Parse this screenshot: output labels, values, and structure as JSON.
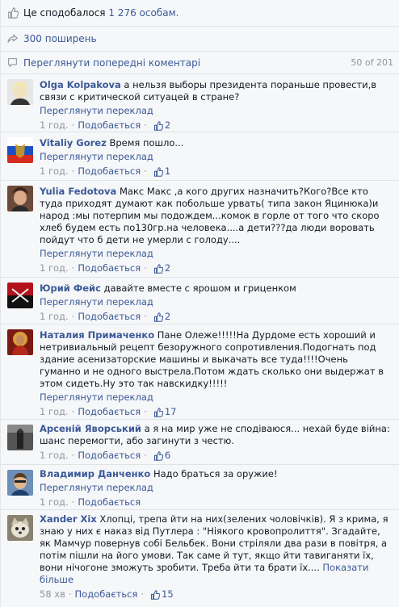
{
  "likes": {
    "prefix": "Це сподобалося",
    "count": "1 276 особам."
  },
  "shares": {
    "label": "300 поширень"
  },
  "previous": {
    "label": "Переглянути попередні коментарі",
    "counter": "50 of 201"
  },
  "translate_label": "Переглянути переклад",
  "like_label": "Подобається",
  "comments": [
    {
      "author": "Olga Kolpakova",
      "text": "а нельзя выборы президента пораньше провести,в связи с критической ситуацей в стране?",
      "time": "1 год.",
      "likes": "2"
    },
    {
      "author": "Vitaliy Gorez",
      "text": "Время пошло...",
      "time": "1 год.",
      "likes": "1"
    },
    {
      "author": "Yulia Fedotova",
      "text": "Макс Макс ,а кого других назначить?Кого?Все кто туда приходят думают как побольше урвать( типа закон Яцинюка)и народ :мы потерпим мы подождем...комок в горле от того что скоро хлеб будем есть по130гр.на человека....а дети???да люди воровать пойдут что б дети не умерли с голоду....",
      "time": "1 год.",
      "likes": "2"
    },
    {
      "author": "Юрий Фейс",
      "text": "давайте вместе с ярошом и гриценком",
      "time": "1 год.",
      "likes": "2"
    },
    {
      "author": "Наталия Примаченко",
      "text": "Пане Олеже!!!!!На Дурдоме есть хороший и нетривиальный рецепт безоружного сопротивления.Подогнать под здание асенизаторские машины и выкачать все туда!!!!Очень гуманно и не одного выстрела.Потом ждать сколько они выдержат в этом сидеть.Ну это так навскидку!!!!!",
      "time": "1 год.",
      "likes": "17"
    },
    {
      "author": "Арсеній Яворський",
      "text": "а я на мир уже не сподіваюся... нехай буде війна: шанс перемогти, або загинути з честю.",
      "time": "1 год.",
      "likes": "6"
    },
    {
      "author": "Владимир Данченко",
      "text": "Надо браться за оружие!",
      "time": "1 год.",
      "likes": ""
    },
    {
      "author": "Xander Xix",
      "text": "Хлопці, трепа йти на них(зелених чоловічків). Я з крима, я знаю у них є наказ від Путлера : \"Ніякого кровопролиття\". Згадайте, як Мамчур повернув собі Бельбек. Вони стріляли два рази в повітря, а потім пішли на його умови. Так саме й тут, якщо йти тавиганяти їх, вони нічогоне зможуть зробити. Треба йти та брати їх....",
      "show_more": "Показати більше",
      "time": "58 хв",
      "likes": "15"
    }
  ],
  "colors": {
    "link": "#3b5998",
    "muted": "#90949c",
    "background": "#f6f7f9"
  }
}
